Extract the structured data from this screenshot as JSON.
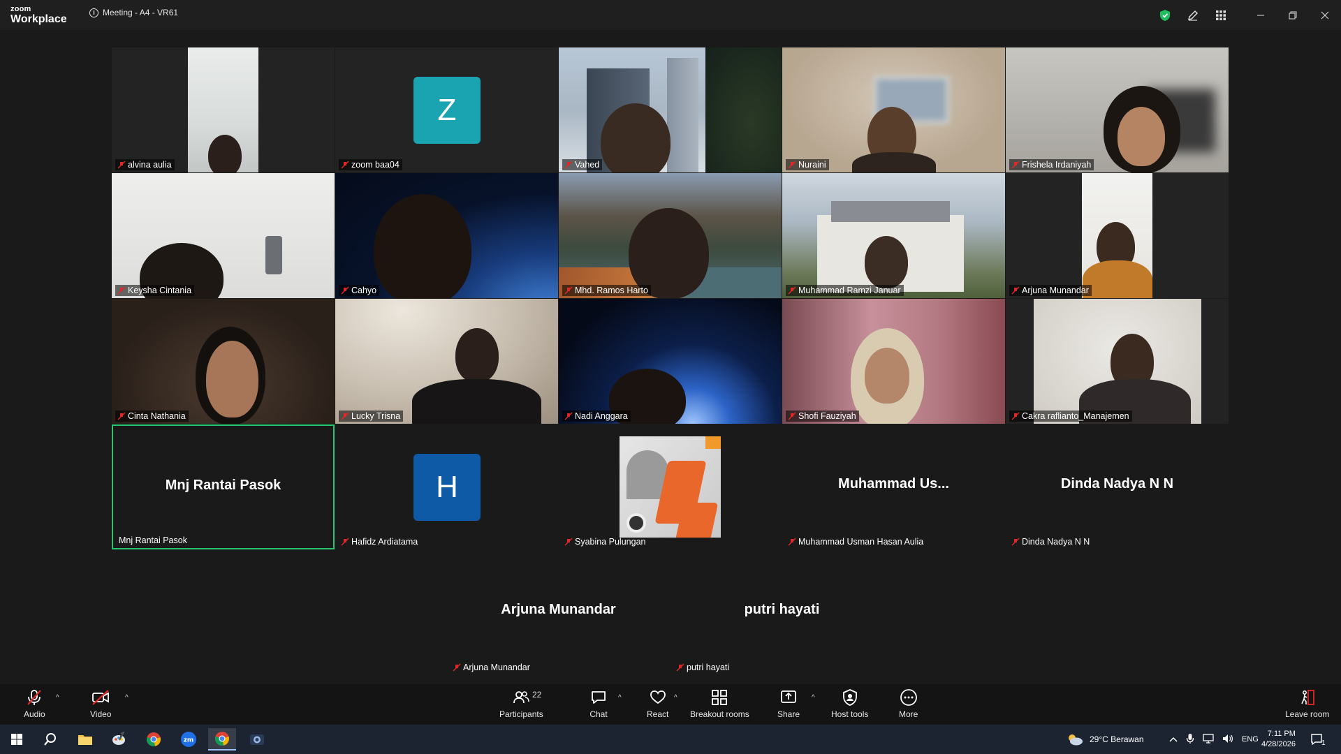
{
  "window": {
    "brand_top": "zoom",
    "brand_bottom": "Workplace",
    "meeting_title": "Meeting - A4 - VR61"
  },
  "tiles": [
    {
      "name": "alvina aulia"
    },
    {
      "name": "zoom baa04",
      "initial": "Z"
    },
    {
      "name": "Vahed"
    },
    {
      "name": "Nuraini"
    },
    {
      "name": "Frishela Irdaniyah"
    },
    {
      "name": "Keysha Cintania"
    },
    {
      "name": "Cahyo"
    },
    {
      "name": "Mhd. Ramos Harto"
    },
    {
      "name": "Muhammad Ramzi Januar"
    },
    {
      "name": "Arjuna Munandar"
    },
    {
      "name": "Cinta Nathania"
    },
    {
      "name": "Lucky Trisna"
    },
    {
      "name": "Nadi Anggara"
    },
    {
      "name": "Shofi Fauziyah"
    },
    {
      "name": "Cakra raflianto_Manajemen"
    },
    {
      "name": "Mnj Rantai Pasok",
      "big": "Mnj Rantai Pasok"
    },
    {
      "name": "Hafidz Ardiatama",
      "initial": "H"
    },
    {
      "name": "Syabina Pulungan"
    },
    {
      "name": "Muhammad Usman Hasan Aulia",
      "big": "Muhammad  Us..."
    },
    {
      "name": "Dinda Nadya N N",
      "big": "Dinda Nadya N N"
    },
    {
      "name": "Arjuna Munandar",
      "big": "Arjuna Munandar"
    },
    {
      "name": "putri hayati",
      "big": "putri hayati"
    }
  ],
  "toolbar": {
    "audio": "Audio",
    "video": "Video",
    "participants": "Participants",
    "participants_count": "22",
    "chat": "Chat",
    "react": "React",
    "breakout": "Breakout rooms",
    "share": "Share",
    "host_tools": "Host tools",
    "more": "More",
    "leave": "Leave room"
  },
  "taskbar": {
    "weather": "29°C  Berawan",
    "lang": "ENG",
    "time": "7:11 PM",
    "date": "4/28/2026",
    "notif_count": "1"
  },
  "colors": {
    "zoom_z_avatar": "#1aa3b0",
    "zoom_h_avatar": "#0e5aa7",
    "active_speaker": "#26c56e",
    "mute_red": "#e02828"
  }
}
